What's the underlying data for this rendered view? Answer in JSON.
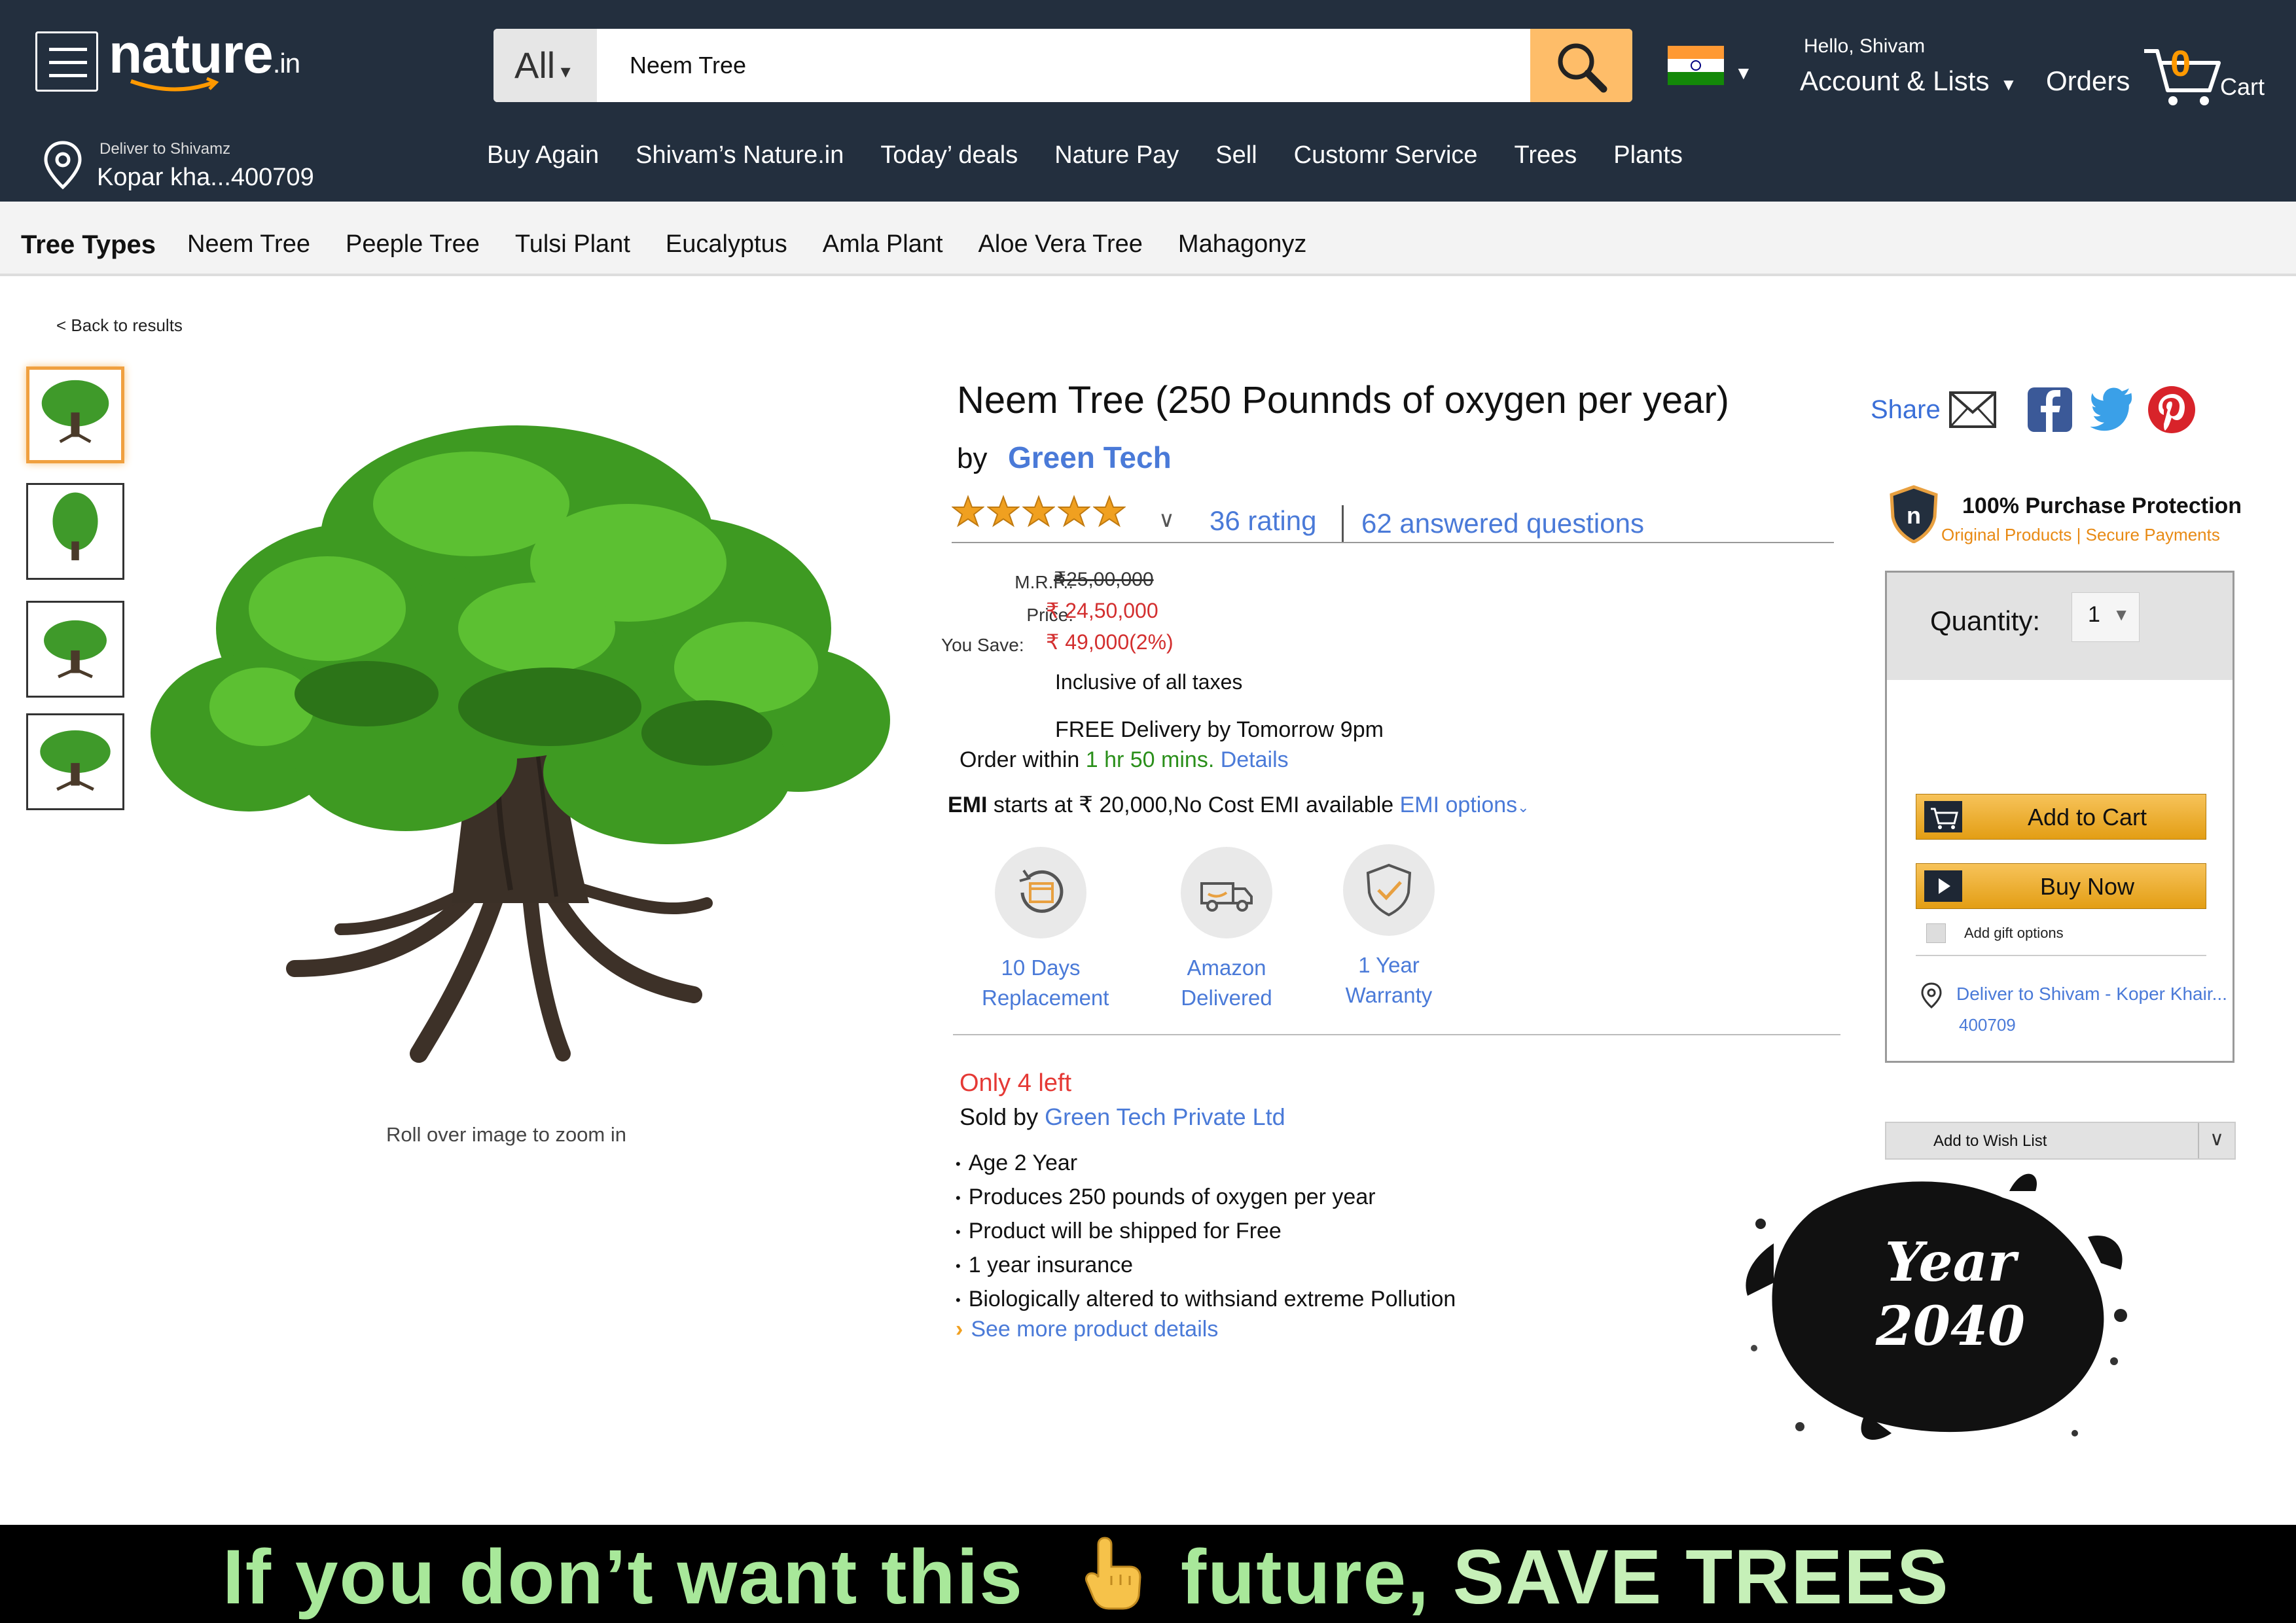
{
  "header": {
    "logo_main": "nature",
    "logo_suffix": ".in",
    "search_category": "All",
    "search_value": "Neem Tree",
    "greeting": "Hello, Shivam",
    "account_label": "Account & Lists",
    "orders_label": "Orders",
    "cart_count": "0",
    "cart_label": "Cart",
    "deliver_line1": "Deliver to Shivamz",
    "deliver_line2": "Kopar kha...400709"
  },
  "subnav": [
    "Buy Again",
    "Shivam’s Nature.in",
    "Today’ deals",
    "Nature Pay",
    "Sell",
    "Customr Service",
    "Trees",
    "Plants"
  ],
  "categories": {
    "title": "Tree Types",
    "items": [
      "Neem Tree",
      "Peeple Tree",
      "Tulsi Plant",
      "Eucalyptus",
      "Amla Plant",
      "Aloe Vera Tree",
      "Mahagonyz"
    ]
  },
  "gallery": {
    "back_link": "< Back to results",
    "zoom_hint": "Roll over image to zoom in"
  },
  "product": {
    "title": "Neem Tree (250 Pounnds of oxygen per year)",
    "by_label": "by",
    "brand": "Green Tech",
    "rating_stars": 5,
    "rating_count": "36 rating",
    "answered": "62 answered questions",
    "mrp_label": "M.R.P.:",
    "mrp_value": "₹25,00,000",
    "price_label": "Price:",
    "price_value": "₹ 24,50,000",
    "save_label": "You Save:",
    "save_value": "₹ 49,000(2%)",
    "taxes": "Inclusive of all taxes",
    "delivery": "FREE Delivery by Tomorrow 9pm",
    "order_within_prefix": "Order within",
    "order_within_time": "1 hr 50 mins.",
    "details_link": "Details",
    "emi_prefix": "EMI",
    "emi_text": "starts at ₹ 20,000,No Cost EMI available",
    "emi_link": "EMI options",
    "features": [
      {
        "line1": "10 Days",
        "line2": "Replacement",
        "icon": "replacement-icon"
      },
      {
        "line1": "Amazon",
        "line2": "Delivered",
        "icon": "delivery-truck-icon"
      },
      {
        "line1": "1 Year",
        "line2": "Warranty",
        "icon": "warranty-shield-icon"
      }
    ],
    "stock": "Only 4 left",
    "sold_by_label": "Sold by",
    "seller": "Green Tech Private Ltd",
    "bullets": [
      "Age 2 Year",
      "Produces 250 pounds of oxygen per year",
      "Product will be shipped for Free",
      "1 year insurance",
      "Biologically altered to withsiand extreme Pollution"
    ],
    "see_more": "See more product details"
  },
  "sidebar": {
    "share_label": "Share",
    "protection_title": "100% Purchase Protection",
    "protection_sub_a": "Original Products",
    "protection_sub_b": "Secure Payments",
    "quantity_label": "Quantity:",
    "quantity_value": "1",
    "add_to_cart": "Add to Cart",
    "buy_now": "Buy Now",
    "gift_label": "Add gift options",
    "deliver_to": "Deliver to Shivam - Koper Khair...",
    "deliver_zip": "400709",
    "wishlist": "Add to Wish List"
  },
  "poster": {
    "year_line1": "Year",
    "year_line2": "2040",
    "banner_part1": "If you don’t want this",
    "banner_part2": "future,",
    "banner_part3": "SAVE TREES"
  },
  "colors": {
    "header_bg": "#232f3e",
    "accent_orange": "#febd69",
    "link_blue": "#4a7ad8",
    "price_red": "#d32f2f",
    "banner_green": "#a8e89a"
  }
}
